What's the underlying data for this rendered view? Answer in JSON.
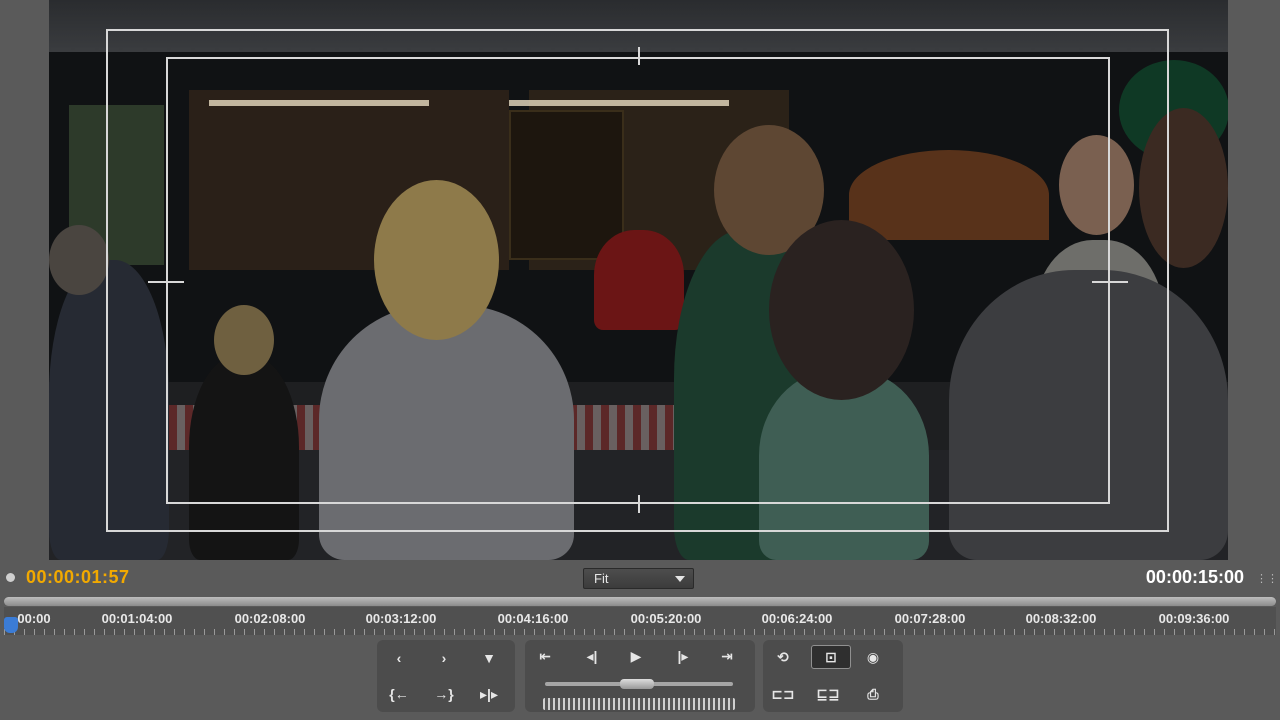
{
  "monitor": {
    "current_timecode": "00:00:01:57",
    "duration_timecode": "00:00:15:00",
    "zoom_select": "Fit"
  },
  "ruler": {
    "labels": [
      "00:00",
      "00:01:04:00",
      "00:02:08:00",
      "00:03:12:00",
      "00:04:16:00",
      "00:05:20:00",
      "00:06:24:00",
      "00:07:28:00",
      "00:08:32:00",
      "00:09:36:00"
    ]
  },
  "transport": {
    "left_group": [
      "mark-in-icon",
      "mark-out-icon",
      "add-marker-icon",
      "go-to-in-icon",
      "go-to-out-icon",
      "play-in-to-out-icon"
    ],
    "center_group": [
      "go-to-previous-edit-icon",
      "step-back-icon",
      "play-icon",
      "step-forward-icon",
      "go-to-next-edit-icon"
    ],
    "right_group": [
      "loop-icon",
      "safe-margins-icon",
      "output-icon",
      "insert-icon",
      "overlay-icon",
      "export-frame-icon"
    ]
  },
  "colors": {
    "timecode_current": "#f2a900",
    "timecode_duration": "#ffffff",
    "playhead": "#3b7cd6",
    "panel_bg": "#5a5a5a"
  }
}
